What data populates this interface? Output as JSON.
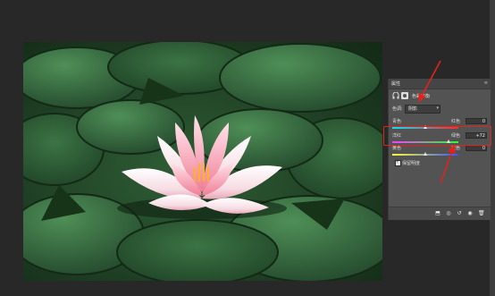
{
  "panel": {
    "tab_label": "属性",
    "menu_icon": "menu-icon",
    "title": "色彩平衡",
    "tone_label": "色调:",
    "tone_value": "阴影",
    "sliders": [
      {
        "left": "青色",
        "right": "红色",
        "value": "0",
        "level": 0.5,
        "color_left": "#00e5ff",
        "color_right": "#ff2a2a"
      },
      {
        "left": "洋红",
        "right": "绿色",
        "value": "+72",
        "level": 0.86,
        "color_left": "#ff3bff",
        "color_right": "#2aff2a"
      },
      {
        "left": "黄色",
        "right": "蓝色",
        "value": "0",
        "level": 0.5,
        "color_left": "#ffff33",
        "color_right": "#3355ff"
      }
    ],
    "preserve_label": "保留明度",
    "preserve_checked": true,
    "bottom_icons": [
      "clip-icon",
      "view-previous-icon",
      "reset-icon",
      "visibility-icon",
      "delete-icon"
    ]
  },
  "colors": {
    "panel_bg": "#535353",
    "canvas_bg": "#282828",
    "highlight": "#e0241b",
    "leaf_dark": "#17331b",
    "leaf_light": "#3f7a48"
  }
}
